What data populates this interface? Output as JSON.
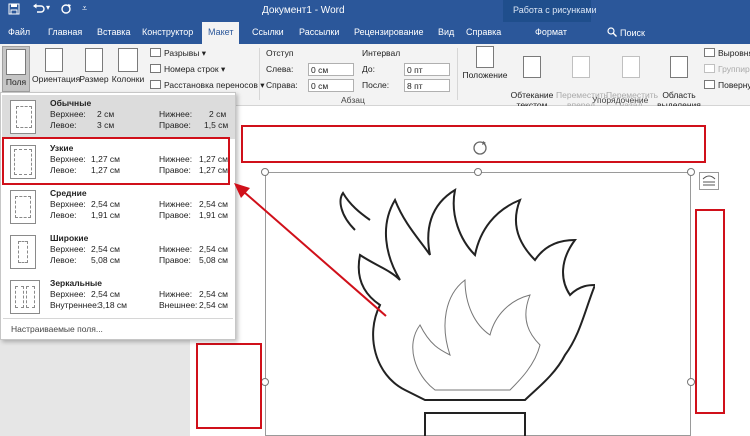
{
  "titlebar": {
    "save_icon": "save-icon",
    "undo_icon": "undo-icon",
    "redo_icon": "redo-icon",
    "customize_icon": "customize-qat-icon",
    "document_title": "Документ1  -  Word",
    "context_group": "Работа с рисунками"
  },
  "tabs": [
    "Файл",
    "Главная",
    "Вставка",
    "Конструктор",
    "Макет",
    "Ссылки",
    "Рассылки",
    "Рецензирование",
    "Вид",
    "Справка",
    "Формат"
  ],
  "active_tab": "Макет",
  "search_label": "Поиск",
  "ribbon": {
    "margins_label": "Поля",
    "orientation_label": "Ориентация",
    "size_label": "Размер",
    "columns_label": "Колонки",
    "breaks_label": "Разрывы",
    "line_numbers_label": "Номера строк",
    "hyphenation_label": "Расстановка переносов",
    "indent_header": "Отступ",
    "spacing_header": "Интервал",
    "left_label": "Слева:",
    "left_value": "0 см",
    "right_label": "Справа:",
    "right_value": "0 см",
    "before_label": "До:",
    "before_value": "0 пт",
    "after_label": "После:",
    "after_value": "8 пт",
    "paragraph_group": "Абзац",
    "position_label": "Положение",
    "wrap_label": "Обтекание\nтекстом",
    "bring_forward_label": "Переместить\nвперед",
    "send_backward_label": "Переместить\nназад",
    "selection_pane_label": "Область\nвыделения",
    "arrange_group": "Упорядочение",
    "align_label": "Выровнять",
    "group_label": "Группиров",
    "rotate_label": "Повернут"
  },
  "margins_menu": [
    {
      "name": "Обычные",
      "top_label": "Верхнее:",
      "top": "2 см",
      "bottom_label": "Нижнее:",
      "bottom": "2 см",
      "left_label": "Левое:",
      "left": "3 см",
      "right_label": "Правое:",
      "right": "1,5 см"
    },
    {
      "name": "Узкие",
      "top_label": "Верхнее:",
      "top": "1,27 см",
      "bottom_label": "Нижнее:",
      "bottom": "1,27 см",
      "left_label": "Левое:",
      "left": "1,27 см",
      "right_label": "Правое:",
      "right": "1,27 см"
    },
    {
      "name": "Средние",
      "top_label": "Верхнее:",
      "top": "2,54 см",
      "bottom_label": "Нижнее:",
      "bottom": "2,54 см",
      "left_label": "Левое:",
      "left": "1,91 см",
      "right_label": "Правое:",
      "right": "1,91 см"
    },
    {
      "name": "Широкие",
      "top_label": "Верхнее:",
      "top": "2,54 см",
      "bottom_label": "Нижнее:",
      "bottom": "2,54 см",
      "left_label": "Левое:",
      "left": "5,08 см",
      "right_label": "Правое:",
      "right": "5,08 см"
    },
    {
      "name": "Зеркальные",
      "top_label": "Верхнее:",
      "top": "2,54 см",
      "bottom_label": "Нижнее:",
      "bottom": "2,54 см",
      "left_label": "Внутреннее:",
      "left": "3,18 см",
      "right_label": "Внешнее:",
      "right": "2,54 см"
    }
  ],
  "custom_margins": "Настраиваемые поля...",
  "colors": {
    "accent": "#2b579a",
    "highlight": "#d0101a"
  }
}
